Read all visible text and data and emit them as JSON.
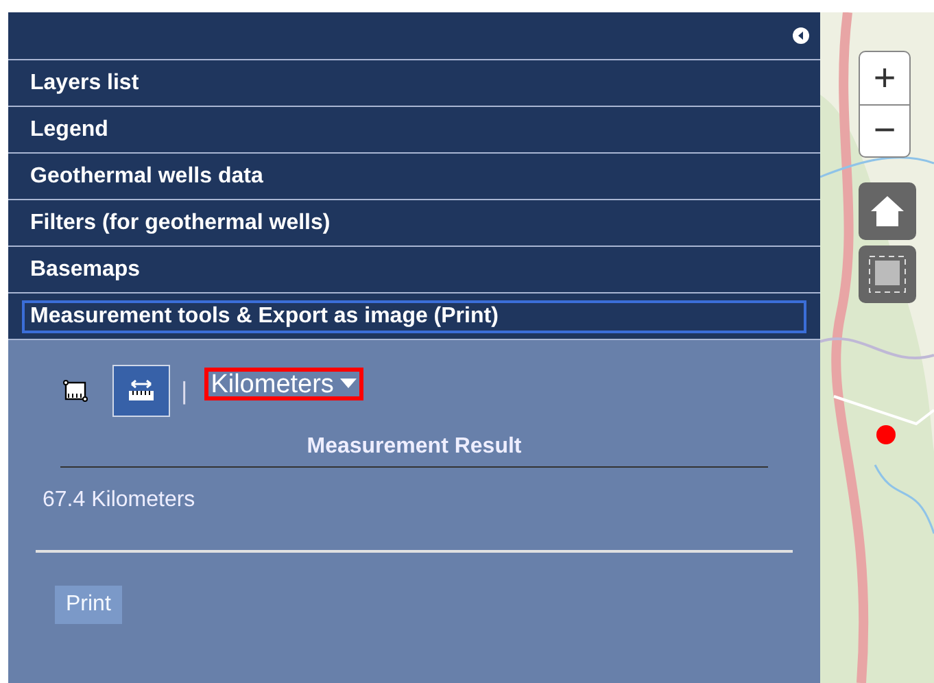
{
  "sections": [
    {
      "label": "Layers list",
      "selected": false
    },
    {
      "label": "Legend",
      "selected": false
    },
    {
      "label": "Geothermal wells data",
      "selected": false
    },
    {
      "label": "Filters (for geothermal wells)",
      "selected": false
    },
    {
      "label": "Basemaps",
      "selected": false
    },
    {
      "label": "Measurement tools & Export as image (Print)",
      "selected": true
    }
  ],
  "measurement": {
    "tools": [
      {
        "kind": "area",
        "selected": false
      },
      {
        "kind": "distance",
        "selected": true
      }
    ],
    "separator": "|",
    "unit": "Kilometers",
    "result_title": "Measurement Result",
    "result": "67.4 Kilometers"
  },
  "print_button": {
    "label": "Print",
    "disabled": true
  },
  "map": {
    "kind": "picture",
    "controls": [
      "+",
      "−"
    ]
  }
}
